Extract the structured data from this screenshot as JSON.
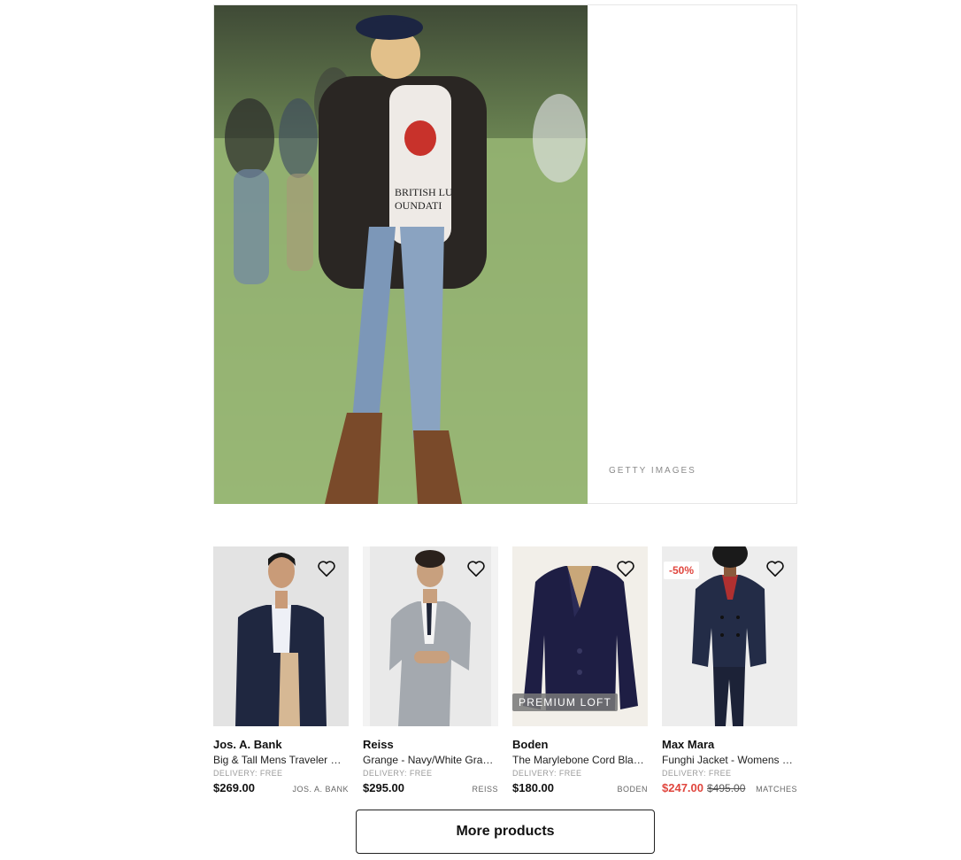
{
  "hero": {
    "image_alt": "Woman in blazer, balloon t-shirt, jeans and brown boots walking on grass",
    "credit": "GETTY IMAGES"
  },
  "products": [
    {
      "brand": "Jos. A. Bank",
      "name": "Big & Tall Mens Traveler Collection Blazer",
      "delivery": "DELIVERY: FREE",
      "price": "$269.00",
      "retailer": "JOS. A. BANK",
      "image": "navy blazer on man"
    },
    {
      "brand": "Reiss",
      "name": "Grange - Navy/White Gradient Check Blazer",
      "delivery": "DELIVERY: FREE",
      "price": "$295.00",
      "retailer": "REISS",
      "image": "grey check suit on man"
    },
    {
      "brand": "Boden",
      "name": "The Marylebone Cord Blazer",
      "delivery": "DELIVERY: FREE",
      "price": "$180.00",
      "retailer": "BODEN",
      "badge": "PREMIUM LOFT",
      "image": "navy corduroy blazer"
    },
    {
      "brand": "Max Mara",
      "name": "Funghi Jacket - Womens Navy",
      "delivery": "DELIVERY: FREE",
      "price": "$247.00",
      "old_price": "$495.00",
      "retailer": "MATCHES",
      "discount": "-50%",
      "image": "navy double breasted jacket on woman"
    }
  ],
  "more_button": "More products",
  "colors": {
    "sale": "#e0463e",
    "navy": "#1f2740",
    "border": "#222222"
  }
}
